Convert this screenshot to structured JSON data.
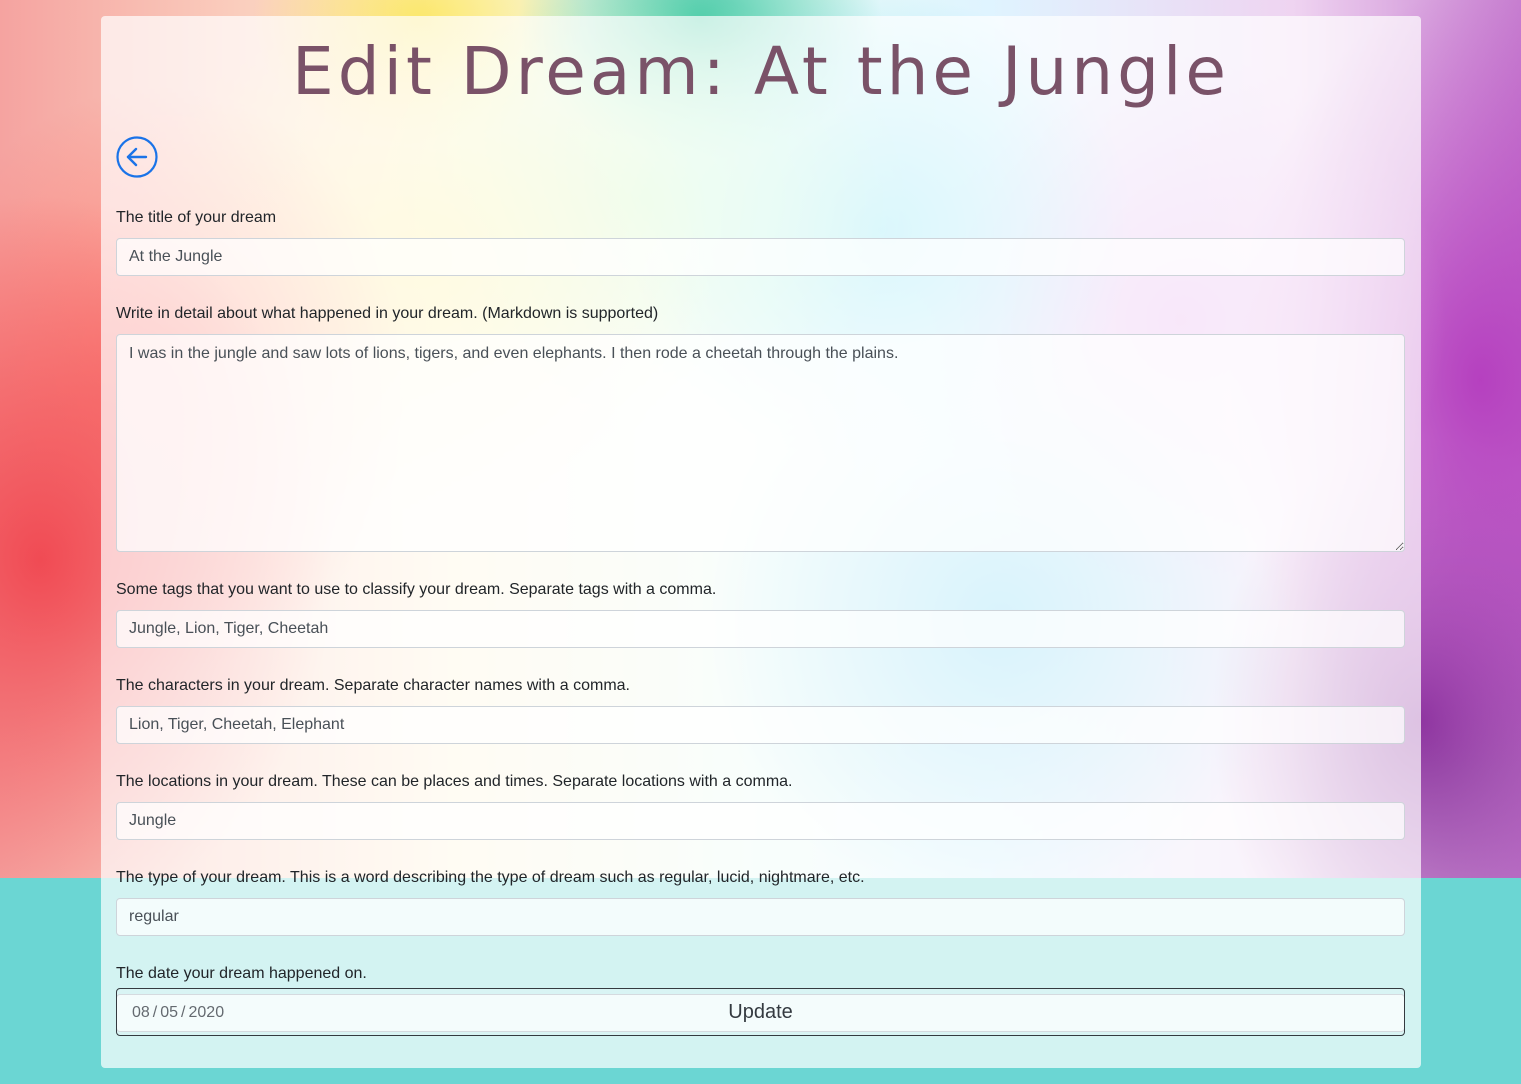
{
  "header": {
    "title": "Edit Dream: At the Jungle"
  },
  "nav": {
    "back_icon": "arrow-left-circle-icon",
    "accent_color": "#1a73e8"
  },
  "form": {
    "title": {
      "label": "The title of your dream",
      "value": "At the Jungle"
    },
    "description": {
      "label": "Write in detail about what happened in your dream. (Markdown is supported)",
      "value": "I was in the jungle and saw lots of lions, tigers, and even elephants. I then rode a cheetah through the plains."
    },
    "tags": {
      "label": "Some tags that you want to use to classify your dream. Separate tags with a comma.",
      "value": "Jungle, Lion, Tiger, Cheetah"
    },
    "characters": {
      "label": "The characters in your dream. Separate character names with a comma.",
      "value": "Lion, Tiger, Cheetah, Elephant"
    },
    "locations": {
      "label": "The locations in your dream. These can be places and times. Separate locations with a comma.",
      "value": "Jungle"
    },
    "type": {
      "label": "The type of your dream. This is a word describing the type of dream such as regular, lucid, nightmare, etc.",
      "value": "regular"
    },
    "date": {
      "label": "The date your dream happened on.",
      "month": "08",
      "day": "05",
      "year": "2020",
      "separator": "/"
    },
    "submit_label": "Update"
  },
  "theme": {
    "title_color": "#7a5268",
    "page_bottom_color": "#6bd6d3"
  }
}
